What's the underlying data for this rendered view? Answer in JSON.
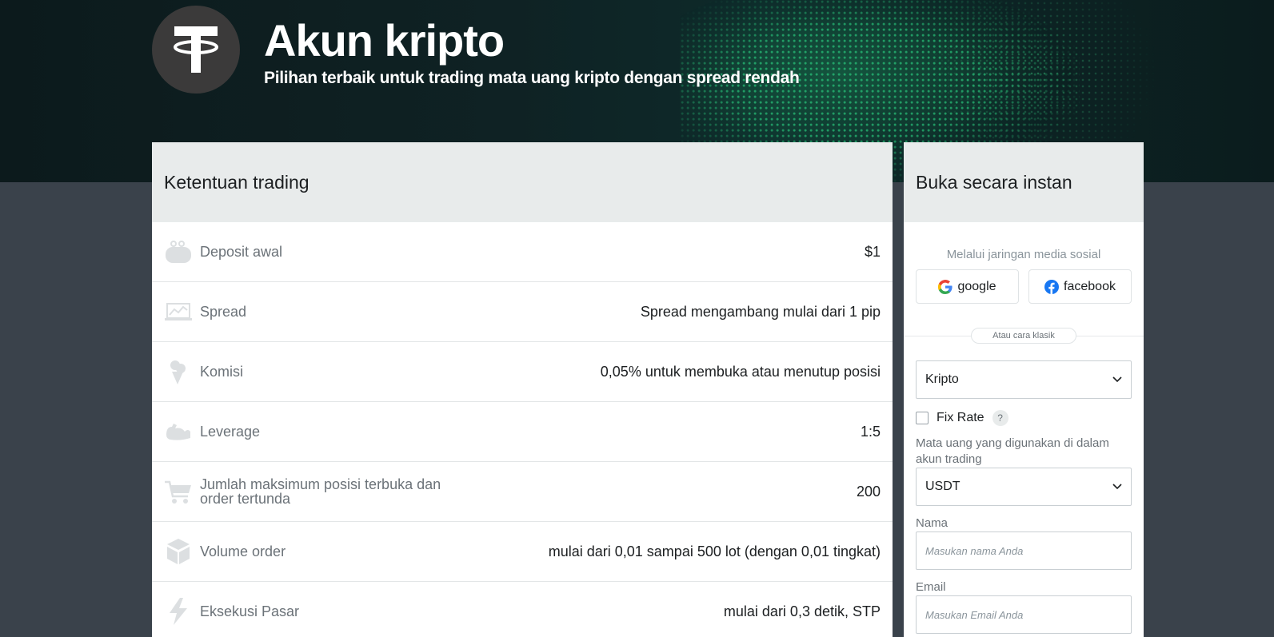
{
  "hero": {
    "title": "Akun kripto",
    "subtitle": "Pilihan terbaik untuk trading mata uang kripto dengan spread rendah",
    "logo_icon": "tether-icon"
  },
  "trading": {
    "title": "Ketentuan trading",
    "rows": [
      {
        "icon": "wallet-icon",
        "label": "Deposit awal",
        "value": "$1"
      },
      {
        "icon": "chart-icon",
        "label": "Spread",
        "value": "Spread mengambang mulai dari 1 pip"
      },
      {
        "icon": "ice-cream-icon",
        "label": "Komisi",
        "value": "0,05% untuk membuka atau menutup posisi"
      },
      {
        "icon": "muscle-icon",
        "label": "Leverage",
        "value": "1:5"
      },
      {
        "icon": "cart-icon",
        "label": "Jumlah maksimum posisi terbuka dan order tertunda",
        "value": "200"
      },
      {
        "icon": "boxes-icon",
        "label": "Volume order",
        "value": "mulai dari 0,01 sampai 500 lot (dengan 0,01 tingkat)"
      },
      {
        "icon": "lightning-icon",
        "label": "Eksekusi Pasar",
        "value": "mulai dari 0,3 detik, STP"
      }
    ]
  },
  "signup": {
    "title": "Buka secara instan",
    "social_label": "Melalui jaringan media sosial",
    "google_label": "google",
    "facebook_label": "facebook",
    "divider_label": "Atau cara klasik",
    "account_type": "Kripto",
    "fix_rate_label": "Fix Rate",
    "help_label": "?",
    "currency_label": "Mata uang yang digunakan di dalam akun trading",
    "currency": "USDT",
    "name_label": "Nama",
    "name_placeholder": "Masukan nama Anda",
    "email_label": "Email",
    "email_placeholder": "Masukan Email Anda"
  },
  "colors": {
    "hero_bg": "#0f2224",
    "page_bg": "#3a424b",
    "card_header_bg": "#e8ebeb",
    "accent_green": "#2ee68c"
  }
}
